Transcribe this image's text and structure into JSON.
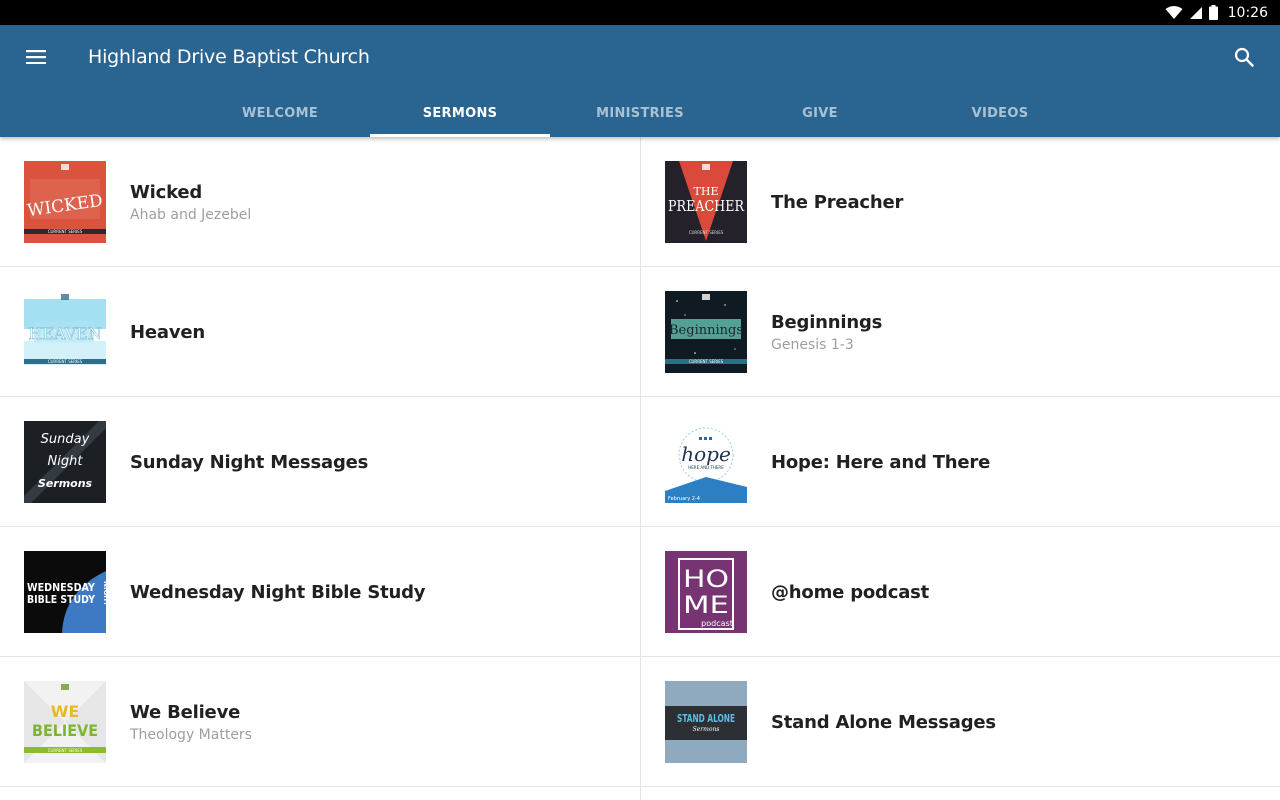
{
  "status_bar": {
    "time": "10:26"
  },
  "app_bar": {
    "title": "Highland Drive Baptist Church"
  },
  "tabs": [
    {
      "label": "WELCOME",
      "active": false
    },
    {
      "label": "SERMONS",
      "active": true
    },
    {
      "label": "MINISTRIES",
      "active": false
    },
    {
      "label": "GIVE",
      "active": false
    },
    {
      "label": "VIDEOS",
      "active": false
    }
  ],
  "series": [
    {
      "title": "Wicked",
      "subtitle": "Ahab and Jezebel",
      "art_text": "WICKED",
      "art_caption": "CURRENT SERIES"
    },
    {
      "title": "The Preacher",
      "subtitle": "",
      "art_text": "THE PREACHER",
      "art_caption": "CURRENT SERIES"
    },
    {
      "title": "Heaven",
      "subtitle": "",
      "art_text": "HEAVEN",
      "art_caption": "CURRENT SERIES"
    },
    {
      "title": "Beginnings",
      "subtitle": "Genesis 1-3",
      "art_text": "Beginnings",
      "art_caption": "CURRENT SERIES"
    },
    {
      "title": "Sunday Night Messages",
      "subtitle": "",
      "art_text": [
        "Sunday",
        "Night",
        "Sermons"
      ]
    },
    {
      "title": "Hope: Here and There",
      "subtitle": "",
      "art_text": "hope",
      "art_caption": "HERE AND THERE",
      "art_date": "February 2-4"
    },
    {
      "title": "Wednesday Night Bible Study",
      "subtitle": "",
      "art_text": [
        "WEDNESDAY",
        "BIBLE STUDY",
        "NIGHT"
      ]
    },
    {
      "title": "@home podcast",
      "subtitle": "",
      "art_text": [
        "HO",
        "ME"
      ],
      "art_caption": "podcast"
    },
    {
      "title": "We Believe",
      "subtitle": "Theology Matters",
      "art_text": [
        "WE",
        "BELIEVE"
      ],
      "art_caption": "CURRENT SERIES"
    },
    {
      "title": "Stand Alone Messages",
      "subtitle": "",
      "art_text": "STAND ALONE",
      "art_caption": "Sermons"
    }
  ],
  "colors": {
    "app_bar": "#2a6491",
    "status_bar": "#000000",
    "tab_indicator": "#ffffff"
  },
  "icons": [
    "menu-icon",
    "search-icon",
    "wifi-icon",
    "cell-signal-icon",
    "battery-icon"
  ]
}
